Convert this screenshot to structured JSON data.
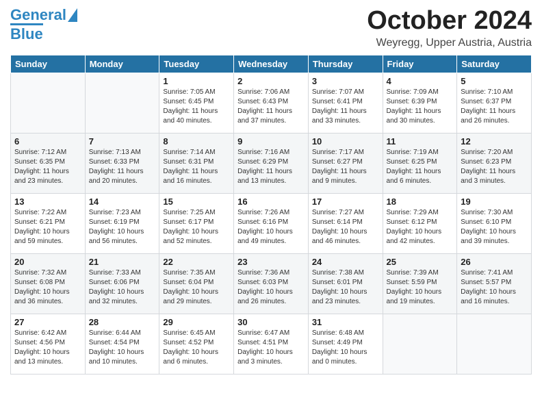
{
  "header": {
    "logo_line1": "General",
    "logo_line2": "Blue",
    "month": "October 2024",
    "location": "Weyregg, Upper Austria, Austria"
  },
  "weekdays": [
    "Sunday",
    "Monday",
    "Tuesday",
    "Wednesday",
    "Thursday",
    "Friday",
    "Saturday"
  ],
  "weeks": [
    [
      {
        "day": "",
        "info": ""
      },
      {
        "day": "",
        "info": ""
      },
      {
        "day": "1",
        "info": "Sunrise: 7:05 AM\nSunset: 6:45 PM\nDaylight: 11 hours and 40 minutes."
      },
      {
        "day": "2",
        "info": "Sunrise: 7:06 AM\nSunset: 6:43 PM\nDaylight: 11 hours and 37 minutes."
      },
      {
        "day": "3",
        "info": "Sunrise: 7:07 AM\nSunset: 6:41 PM\nDaylight: 11 hours and 33 minutes."
      },
      {
        "day": "4",
        "info": "Sunrise: 7:09 AM\nSunset: 6:39 PM\nDaylight: 11 hours and 30 minutes."
      },
      {
        "day": "5",
        "info": "Sunrise: 7:10 AM\nSunset: 6:37 PM\nDaylight: 11 hours and 26 minutes."
      }
    ],
    [
      {
        "day": "6",
        "info": "Sunrise: 7:12 AM\nSunset: 6:35 PM\nDaylight: 11 hours and 23 minutes."
      },
      {
        "day": "7",
        "info": "Sunrise: 7:13 AM\nSunset: 6:33 PM\nDaylight: 11 hours and 20 minutes."
      },
      {
        "day": "8",
        "info": "Sunrise: 7:14 AM\nSunset: 6:31 PM\nDaylight: 11 hours and 16 minutes."
      },
      {
        "day": "9",
        "info": "Sunrise: 7:16 AM\nSunset: 6:29 PM\nDaylight: 11 hours and 13 minutes."
      },
      {
        "day": "10",
        "info": "Sunrise: 7:17 AM\nSunset: 6:27 PM\nDaylight: 11 hours and 9 minutes."
      },
      {
        "day": "11",
        "info": "Sunrise: 7:19 AM\nSunset: 6:25 PM\nDaylight: 11 hours and 6 minutes."
      },
      {
        "day": "12",
        "info": "Sunrise: 7:20 AM\nSunset: 6:23 PM\nDaylight: 11 hours and 3 minutes."
      }
    ],
    [
      {
        "day": "13",
        "info": "Sunrise: 7:22 AM\nSunset: 6:21 PM\nDaylight: 10 hours and 59 minutes."
      },
      {
        "day": "14",
        "info": "Sunrise: 7:23 AM\nSunset: 6:19 PM\nDaylight: 10 hours and 56 minutes."
      },
      {
        "day": "15",
        "info": "Sunrise: 7:25 AM\nSunset: 6:17 PM\nDaylight: 10 hours and 52 minutes."
      },
      {
        "day": "16",
        "info": "Sunrise: 7:26 AM\nSunset: 6:16 PM\nDaylight: 10 hours and 49 minutes."
      },
      {
        "day": "17",
        "info": "Sunrise: 7:27 AM\nSunset: 6:14 PM\nDaylight: 10 hours and 46 minutes."
      },
      {
        "day": "18",
        "info": "Sunrise: 7:29 AM\nSunset: 6:12 PM\nDaylight: 10 hours and 42 minutes."
      },
      {
        "day": "19",
        "info": "Sunrise: 7:30 AM\nSunset: 6:10 PM\nDaylight: 10 hours and 39 minutes."
      }
    ],
    [
      {
        "day": "20",
        "info": "Sunrise: 7:32 AM\nSunset: 6:08 PM\nDaylight: 10 hours and 36 minutes."
      },
      {
        "day": "21",
        "info": "Sunrise: 7:33 AM\nSunset: 6:06 PM\nDaylight: 10 hours and 32 minutes."
      },
      {
        "day": "22",
        "info": "Sunrise: 7:35 AM\nSunset: 6:04 PM\nDaylight: 10 hours and 29 minutes."
      },
      {
        "day": "23",
        "info": "Sunrise: 7:36 AM\nSunset: 6:03 PM\nDaylight: 10 hours and 26 minutes."
      },
      {
        "day": "24",
        "info": "Sunrise: 7:38 AM\nSunset: 6:01 PM\nDaylight: 10 hours and 23 minutes."
      },
      {
        "day": "25",
        "info": "Sunrise: 7:39 AM\nSunset: 5:59 PM\nDaylight: 10 hours and 19 minutes."
      },
      {
        "day": "26",
        "info": "Sunrise: 7:41 AM\nSunset: 5:57 PM\nDaylight: 10 hours and 16 minutes."
      }
    ],
    [
      {
        "day": "27",
        "info": "Sunrise: 6:42 AM\nSunset: 4:56 PM\nDaylight: 10 hours and 13 minutes."
      },
      {
        "day": "28",
        "info": "Sunrise: 6:44 AM\nSunset: 4:54 PM\nDaylight: 10 hours and 10 minutes."
      },
      {
        "day": "29",
        "info": "Sunrise: 6:45 AM\nSunset: 4:52 PM\nDaylight: 10 hours and 6 minutes."
      },
      {
        "day": "30",
        "info": "Sunrise: 6:47 AM\nSunset: 4:51 PM\nDaylight: 10 hours and 3 minutes."
      },
      {
        "day": "31",
        "info": "Sunrise: 6:48 AM\nSunset: 4:49 PM\nDaylight: 10 hours and 0 minutes."
      },
      {
        "day": "",
        "info": ""
      },
      {
        "day": "",
        "info": ""
      }
    ]
  ]
}
